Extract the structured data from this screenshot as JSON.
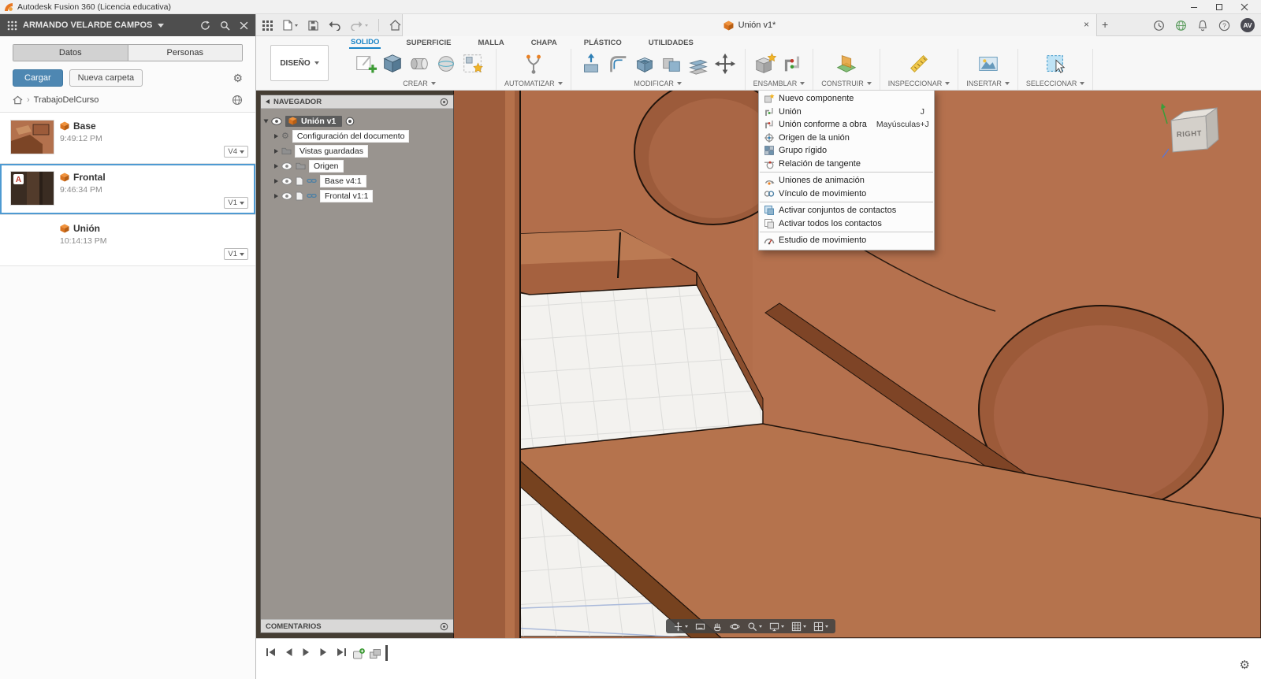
{
  "titlebar": {
    "title": "Autodesk Fusion 360 (Licencia educativa)"
  },
  "data_panel": {
    "header": {
      "user": "ARMANDO VELARDE CAMPOS"
    },
    "tabs": {
      "datos": "Datos",
      "personas": "Personas"
    },
    "actions": {
      "upload": "Cargar",
      "new_folder": "Nueva carpeta"
    },
    "breadcrumb": {
      "folder": "TrabajoDelCurso"
    },
    "items": [
      {
        "name": "Base",
        "time": "9:49:12 PM",
        "version": "V4"
      },
      {
        "name": "Frontal",
        "time": "9:46:34 PM",
        "version": "V1"
      },
      {
        "name": "Unión",
        "time": "10:14:13 PM",
        "version": "V1"
      }
    ]
  },
  "tabbar": {
    "document_tab": "Unión v1*",
    "avatar": "AV"
  },
  "ribbon": {
    "design": "DISEÑO",
    "tabs": [
      "SOLIDO",
      "SUPERFICIE",
      "MALLA",
      "CHAPA",
      "PLÁSTICO",
      "UTILIDADES"
    ],
    "groups": {
      "crear": "CREAR",
      "automatizar": "AUTOMATIZAR",
      "modificar": "MODIFICAR",
      "ensamblar": "ENSAMBLAR",
      "construir": "CONSTRUIR",
      "inspeccionar": "INSPECCIONAR",
      "insertar": "INSERTAR",
      "seleccionar": "SELECCIONAR"
    }
  },
  "assemble_menu": {
    "items": [
      {
        "label": "Nuevo componente",
        "shortcut": ""
      },
      {
        "label": "Unión",
        "shortcut": "J"
      },
      {
        "label": "Unión conforme a obra",
        "shortcut": "Mayúsculas+J"
      },
      {
        "label": "Origen de la unión",
        "shortcut": ""
      },
      {
        "label": "Grupo rígido",
        "shortcut": ""
      },
      {
        "label": "Relación de tangente",
        "shortcut": ""
      },
      {
        "label": "Uniones de animación",
        "shortcut": ""
      },
      {
        "label": "Vínculo de movimiento",
        "shortcut": ""
      },
      {
        "label": "Activar conjuntos de contactos",
        "shortcut": ""
      },
      {
        "label": "Activar todos los contactos",
        "shortcut": ""
      },
      {
        "label": "Estudio de movimiento",
        "shortcut": ""
      }
    ]
  },
  "navigator": {
    "title": "NAVEGADOR",
    "root": "Unión v1",
    "rows": [
      {
        "label": "Configuración del documento"
      },
      {
        "label": "Vistas guardadas"
      },
      {
        "label": "Origen"
      },
      {
        "label": "Base v4:1"
      },
      {
        "label": "Frontal v1:1"
      }
    ],
    "comments": "COMENTARIOS"
  },
  "viewcube": {
    "face": "RIGHT"
  }
}
